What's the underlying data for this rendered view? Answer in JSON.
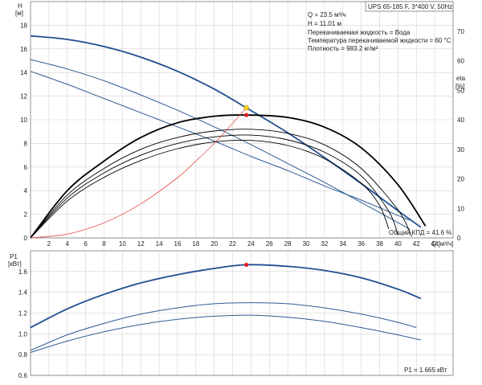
{
  "chart_data": [
    {
      "type": "line",
      "header": "UPS 65-185 F, 3*400 V, 50Hz",
      "info": [
        "Q = 23.5 м³/ч",
        "H = 11.01 м",
        "Перекачиваемая жидкость = Вода",
        "Температура перекачиваемой жидкости = 60 °C",
        "Плотность = 983.2 кг/м³"
      ],
      "ylabel_left": [
        "H",
        "[м]"
      ],
      "ylabel_right": "eta",
      "ylabel_right_unit": "[%]",
      "xlabel": "Q [м³/ч]",
      "xlim": [
        0,
        46
      ],
      "ylim_left": [
        0,
        20
      ],
      "ylim_right": [
        0,
        80
      ],
      "x_ticks": [
        2,
        4,
        6,
        8,
        10,
        12,
        14,
        16,
        18,
        20,
        22,
        24,
        26,
        28,
        30,
        32,
        34,
        36,
        38,
        40,
        42,
        44
      ],
      "y_ticks_left": [
        0,
        2,
        4,
        6,
        8,
        10,
        12,
        14,
        16,
        18
      ],
      "y_ticks_right": [
        0,
        10,
        20,
        30,
        40,
        50,
        60,
        70
      ],
      "grid": true,
      "efficiency_label": "Общий КПД = 41.6 %",
      "colors": {
        "head_main": "#1f4e91",
        "head_other": "#2e5c92",
        "efficiency": "#000000",
        "system": "#e85050",
        "op_head": "#ffd21f",
        "op_eta": "#e32020"
      },
      "series": [
        {
          "role": "head",
          "emphasis": true,
          "x": [
            0,
            4,
            8,
            12,
            16,
            20,
            23.5,
            28,
            32,
            36,
            40,
            42.5
          ],
          "y": [
            17.1,
            16.8,
            16.2,
            15.3,
            14.1,
            12.6,
            11.01,
            8.9,
            6.8,
            4.6,
            2.3,
            0.9
          ]
        },
        {
          "role": "head",
          "emphasis": false,
          "x": [
            0,
            4,
            8,
            12,
            16,
            20,
            24,
            28,
            32,
            36,
            40,
            41.3
          ],
          "y": [
            15.1,
            14.3,
            13.3,
            12.1,
            10.8,
            9.4,
            7.9,
            6.3,
            4.7,
            3.0,
            1.3,
            0.7
          ]
        },
        {
          "role": "head",
          "emphasis": false,
          "x": [
            0,
            4,
            8,
            12,
            16,
            20,
            24,
            28,
            32,
            36,
            40,
            41.2
          ],
          "y": [
            14.1,
            13.0,
            11.8,
            10.6,
            9.4,
            8.2,
            6.9,
            5.7,
            4.4,
            3.2,
            1.9,
            1.5
          ]
        },
        {
          "role": "efficiency",
          "emphasis": true,
          "x": [
            0,
            4,
            8,
            12,
            16,
            20,
            23.5,
            28,
            32,
            36,
            40,
            43
          ],
          "y": [
            0,
            16,
            26,
            34,
            39,
            41.2,
            41.6,
            40.8,
            37.5,
            30.5,
            18,
            4
          ]
        },
        {
          "role": "efficiency",
          "emphasis": false,
          "x": [
            0,
            4,
            8,
            12,
            16,
            20,
            24,
            28,
            32,
            36,
            40,
            41.5
          ],
          "y": [
            0,
            14.5,
            23.5,
            30,
            34,
            36.2,
            36.8,
            35.4,
            31.5,
            23.5,
            9.5,
            0.5
          ]
        },
        {
          "role": "efficiency",
          "emphasis": false,
          "x": [
            0,
            4,
            8,
            12,
            16,
            20,
            24,
            28,
            32,
            36,
            39,
            40
          ],
          "y": [
            0,
            13.5,
            22,
            28,
            32,
            34.2,
            34.8,
            33.2,
            29,
            21,
            9,
            1
          ]
        },
        {
          "role": "efficiency",
          "emphasis": false,
          "x": [
            0,
            4,
            8,
            12,
            16,
            20,
            24,
            28,
            32,
            36,
            38,
            39
          ],
          "y": [
            0,
            12.5,
            20.5,
            26.2,
            30.2,
            32.5,
            33,
            31.3,
            26.8,
            18.5,
            11,
            3
          ]
        },
        {
          "role": "system",
          "emphasis": false,
          "x": [
            0,
            4,
            8,
            12,
            16,
            18,
            20,
            22,
            23.5
          ],
          "y": [
            0,
            0.32,
            1.28,
            2.88,
            5.1,
            6.5,
            8.0,
            9.7,
            11.01
          ]
        }
      ],
      "operating_point_head": {
        "x": 23.5,
        "y": 11.01
      },
      "operating_point_eta": {
        "x": 23.5,
        "y": 41.6
      }
    },
    {
      "type": "line",
      "ylabel": [
        "P1",
        "[кВт]"
      ],
      "xlim": [
        0,
        46
      ],
      "ylim": [
        0.6,
        1.8
      ],
      "y_ticks": [
        0.6,
        0.8,
        1.0,
        1.2,
        1.4,
        1.6
      ],
      "grid": true,
      "power_label": "P1 = 1.665 кВт",
      "series": [
        {
          "role": "power",
          "emphasis": true,
          "x": [
            0,
            4,
            8,
            12,
            16,
            20,
            23.5,
            28,
            32,
            36,
            40,
            42.5
          ],
          "y": [
            1.06,
            1.24,
            1.38,
            1.49,
            1.57,
            1.63,
            1.665,
            1.65,
            1.61,
            1.54,
            1.43,
            1.34
          ]
        },
        {
          "role": "power",
          "emphasis": false,
          "x": [
            0,
            4,
            8,
            12,
            16,
            20,
            24,
            28,
            32,
            36,
            40,
            42
          ],
          "y": [
            0.84,
            0.99,
            1.1,
            1.19,
            1.25,
            1.29,
            1.3,
            1.29,
            1.25,
            1.19,
            1.11,
            1.06
          ]
        },
        {
          "role": "power",
          "emphasis": false,
          "x": [
            0,
            4,
            8,
            12,
            16,
            20,
            24,
            28,
            32,
            36,
            40,
            42.5
          ],
          "y": [
            0.82,
            0.93,
            1.02,
            1.09,
            1.14,
            1.17,
            1.18,
            1.16,
            1.12,
            1.06,
            0.99,
            0.94
          ]
        }
      ],
      "operating_point": {
        "x": 23.5,
        "y": 1.665
      }
    }
  ]
}
